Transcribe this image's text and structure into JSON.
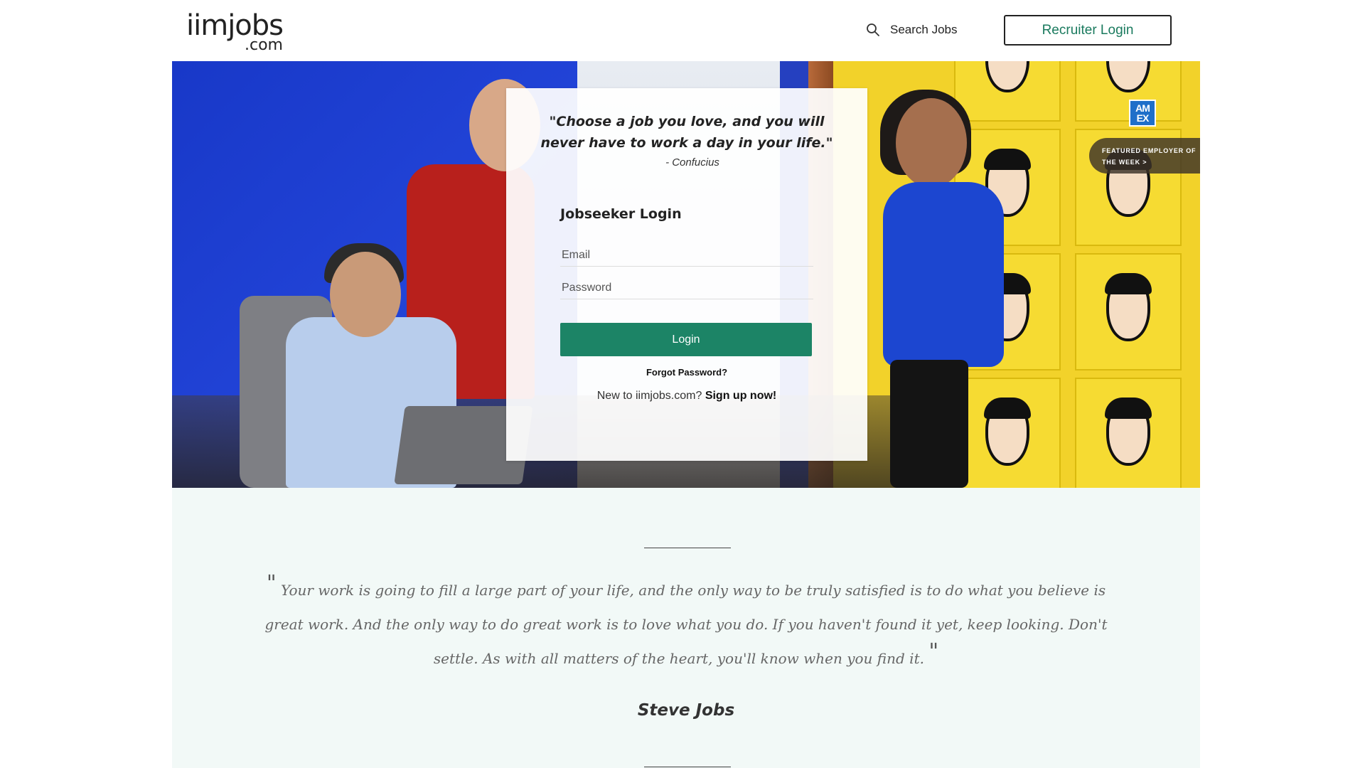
{
  "header": {
    "logo_main": "iimjobs",
    "logo_sub": ".com",
    "search_label": "Search Jobs",
    "recruiter_login_label": "Recruiter Login"
  },
  "hero": {
    "featured_line1": "FEATURED EMPLOYER OF",
    "featured_line2": "THE WEEK >",
    "amex_logo_text": "AM EX"
  },
  "login": {
    "quote": "\"Choose a job you love, and you will never have to work a day in your life.\"",
    "quote_author": "- Confucius",
    "title": "Jobseeker Login",
    "email_placeholder": "Email",
    "password_placeholder": "Password",
    "login_button": "Login",
    "forgot_password": "Forgot Password?",
    "new_user_text": "New to iimjobs.com?",
    "signup_link": "Sign up now!"
  },
  "quote_section": {
    "open_mark": "\"",
    "text": "Your work is going to fill a large part of your life, and the only way to be truly satisfied is to do what you believe is great work. And the only way to do great work is to love what you do. If you haven't found it yet, keep looking. Don't settle. As with all matters of the heart, you'll know when you find it.",
    "close_mark": "\"",
    "author": "Steve Jobs"
  },
  "colors": {
    "accent_green": "#1c8466",
    "recruiter_text": "#1a7a5e",
    "quote_section_bg": "#f2f9f7"
  }
}
